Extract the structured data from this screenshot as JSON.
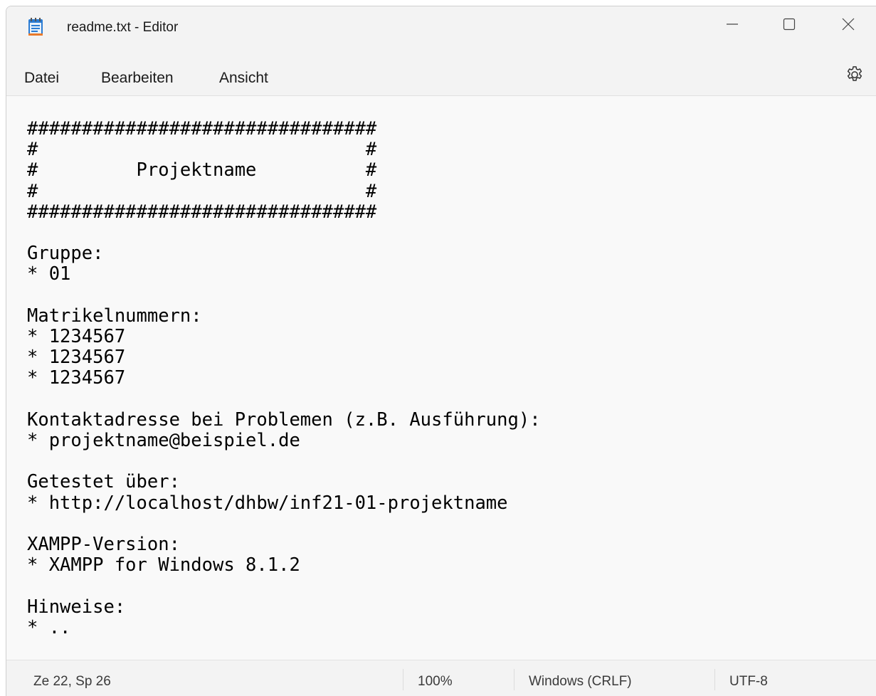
{
  "window": {
    "title": "readme.txt - Editor"
  },
  "menu": {
    "items": [
      "Datei",
      "Bearbeiten",
      "Ansicht"
    ]
  },
  "editor": {
    "lines": [
      "################################",
      "#                              #",
      "#         Projektname          #",
      "#                              #",
      "################################",
      "",
      "Gruppe:",
      "* 01",
      "",
      "Matrikelnummern:",
      "* 1234567",
      "* 1234567",
      "* 1234567",
      "",
      "Kontaktadresse bei Problemen (z.B. Ausführung):",
      "* projektname@beispiel.de",
      "",
      "Getestet über:",
      "* http://localhost/dhbw/inf21-01-projektname",
      "",
      "XAMPP-Version:",
      "* XAMPP for Windows 8.1.2",
      "",
      "Hinweise:",
      "* .."
    ]
  },
  "status": {
    "position": "Ze 22, Sp 26",
    "zoom": "100%",
    "line_ending": "Windows (CRLF)",
    "encoding": "UTF-8"
  },
  "icons": {
    "app": "notepad-icon",
    "minimize": "minimize-icon",
    "maximize": "maximize-icon",
    "close": "close-icon",
    "settings": "gear-icon"
  },
  "colors": {
    "chrome": "#f3f3f3",
    "editor_bg": "#f9f9f9",
    "text": "#000000",
    "app_icon_blue": "#2b7cd3"
  }
}
